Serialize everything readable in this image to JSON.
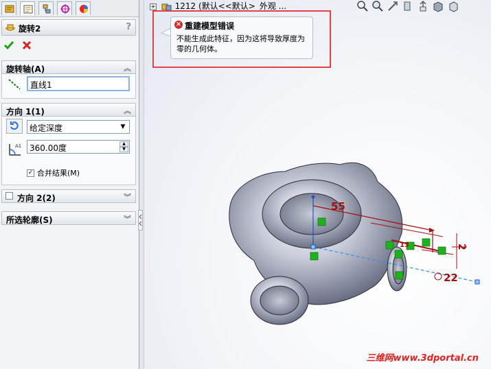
{
  "tabs": [
    "featuremanager-icon",
    "propertymanager-icon",
    "configurationmanager-icon",
    "dimxpert-icon",
    "appearance-icon"
  ],
  "property_manager": {
    "title": "旋转2",
    "help": "?"
  },
  "groups": {
    "axis": {
      "title": "旋转轴(A)",
      "value": "直线1"
    },
    "direction1": {
      "title": "方向 1(1)",
      "end_condition": "给定深度",
      "angle": "360.00度",
      "merge_label": "合并结果(M)",
      "merge_checked": true
    },
    "direction2": {
      "title": "方向 2(2)",
      "checked": false
    },
    "contours": {
      "title": "所选轮廓(S)"
    }
  },
  "viewport": {
    "tree_title": "1212 (默认<<默认>_外观 ...",
    "error": {
      "title": "重建模型错误",
      "message": "不能生成此特征，因为这将导致厚度为零的几何体。"
    },
    "dims": {
      "d1": "55",
      "d2": "2",
      "d3": "22",
      "d4": "13"
    }
  },
  "watermark": "三维网www.3dportal.cn",
  "colors": {
    "error_red": "#e34242",
    "accent_blue": "#1f6fd1",
    "dim_red": "#a01010",
    "constraint_green": "#1db31d"
  }
}
